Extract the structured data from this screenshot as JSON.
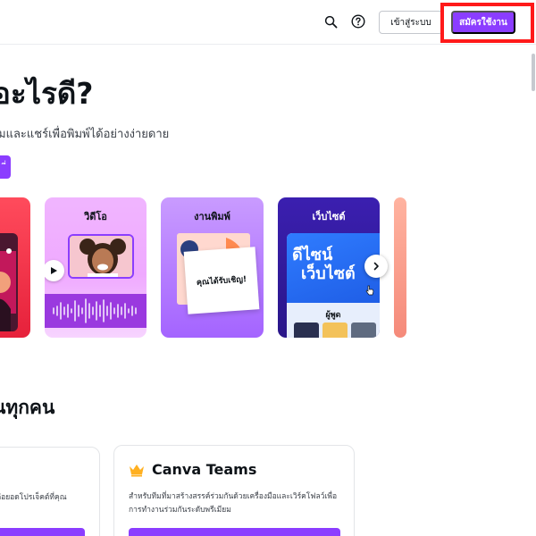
{
  "header": {
    "login_label": "เข้าสู่ระบบ",
    "signup_label": "สมัครใช้งาน"
  },
  "hero": {
    "title": "อะไรดี?",
    "subtitle": "มและแชร์เพื่อพิมพ์ได้อย่างง่ายดาย",
    "cta_label": "ี่"
  },
  "cards": {
    "video_label": "วิดีโอ",
    "print_label": "งานพิมพ์",
    "print_inner_text": "คุณได้รับเชิญ!",
    "web_label": "เว็บไซต์",
    "web_hero_text_1": "ดีไซน์",
    "web_hero_text_2": "เว็บไซต์",
    "web_speaker_label": "ผู้พูด"
  },
  "section": {
    "title": "นทุกคน"
  },
  "plans": {
    "left_desc": "รต่อยอดโปรเจ็คต์ที่คุณ",
    "teams_title": "Canva Teams",
    "teams_desc": "สำหรับทีมที่มาสร้างสรรค์ร่วมกันด้วยเครื่องมือและเวิร์คโฟลว์เพื่อการทำงานร่วมกันระดับพรีเมียม"
  },
  "colors": {
    "brand_purple": "#8b3dff",
    "highlight_red": "#ff1a1a"
  },
  "icons": {
    "search": "search-icon",
    "help": "help-icon",
    "next": "chevron-right-icon",
    "play": "play-icon",
    "crown": "crown-icon"
  }
}
